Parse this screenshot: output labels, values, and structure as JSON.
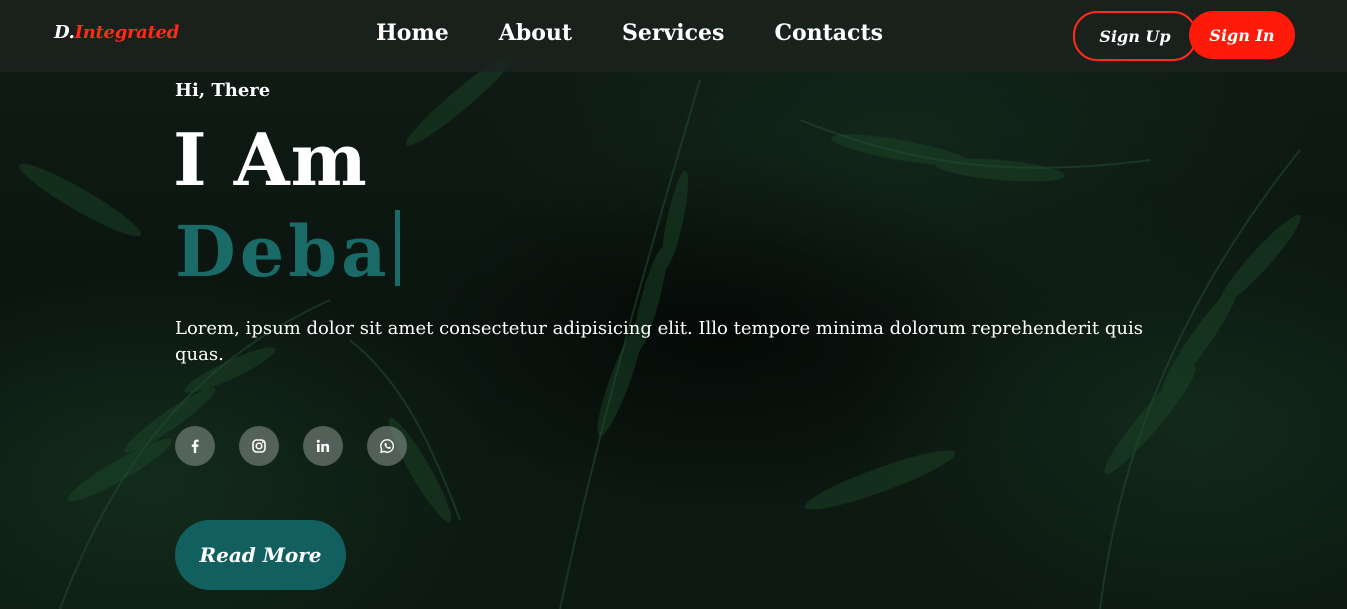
{
  "nav": {
    "brand_prefix": "D.",
    "brand_suffix": "Integrated",
    "links": [
      "Home",
      "About",
      "Services",
      "Contacts"
    ],
    "signup_label": "Sign Up",
    "signin_label": "Sign In"
  },
  "hero": {
    "greeting": "Hi, There",
    "line1": "I Am",
    "typed_name": "Deba",
    "description": "Lorem, ipsum dolor sit amet consectetur adipisicing elit. Illo tempore minima dolorum reprehenderit quis quas.",
    "read_more_label": "Read More"
  },
  "socials": [
    {
      "icon": "facebook-icon"
    },
    {
      "icon": "instagram-icon"
    },
    {
      "icon": "linkedin-icon"
    },
    {
      "icon": "whatsapp-icon"
    }
  ],
  "colors": {
    "accent_red": "#ff1a0a",
    "accent_teal": "#1a6b68",
    "button_teal": "#11605f"
  }
}
